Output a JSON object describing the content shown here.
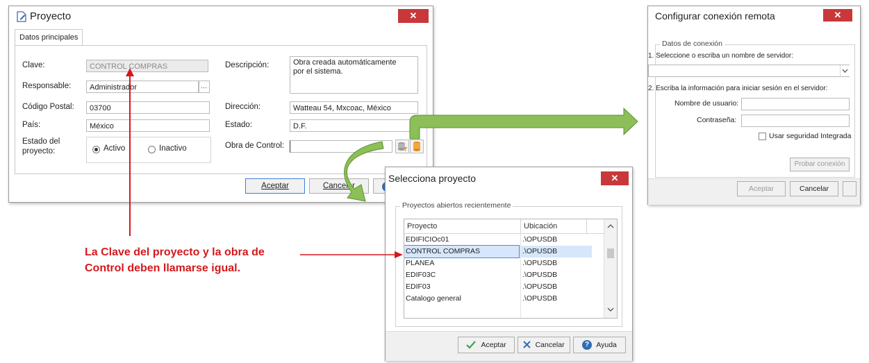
{
  "proyecto_dialog": {
    "title": "Proyecto",
    "close": "✕",
    "tab": "Datos principales",
    "fields": {
      "clave_label": "Clave:",
      "clave_value": "CONTROL COMPRAS",
      "descripcion_label": "Descripción:",
      "descripcion_value": "Obra creada automáticamente por el sistema.",
      "responsable_label": "Responsable:",
      "responsable_value": "Administrador",
      "responsable_button": "···",
      "codigo_postal_label": "Código Postal:",
      "codigo_postal_value": "03700",
      "direccion_label": "Dirección:",
      "direccion_value": "Watteau 54, Mxcoac, México",
      "pais_label": "País:",
      "pais_value": "México",
      "estado_label": "Estado:",
      "estado_value": "D.F.",
      "estado_proyecto_label": "Estado del proyecto:",
      "activo_label": "Activo",
      "inactivo_label": "Inactivo",
      "obra_control_label": "Obra de Control:",
      "obra_control_value": ""
    },
    "buttons": {
      "aceptar": "Aceptar",
      "cancelar": "Cancelar"
    }
  },
  "selecciona_dialog": {
    "title": "Selecciona proyecto",
    "close": "✕",
    "group_title": "Proyectos abiertos recientemente",
    "columns": [
      "Proyecto",
      "Ubicación"
    ],
    "rows": [
      {
        "proyecto": "EDIFICIOc01",
        "ubicacion": ".\\OPUSDB"
      },
      {
        "proyecto": "CONTROL COMPRAS",
        "ubicacion": ".\\OPUSDB"
      },
      {
        "proyecto": "PLANEA",
        "ubicacion": ".\\OPUSDB"
      },
      {
        "proyecto": "EDIF03C",
        "ubicacion": ".\\OPUSDB"
      },
      {
        "proyecto": "EDIF03",
        "ubicacion": ".\\OPUSDB"
      },
      {
        "proyecto": "Catalogo general",
        "ubicacion": ".\\OPUSDB"
      }
    ],
    "buttons": {
      "aceptar": "Aceptar",
      "cancelar": "Cancelar",
      "ayuda": "Ayuda"
    }
  },
  "conexion_dialog": {
    "title": "Configurar conexión remota",
    "close": "✕",
    "group_title": "Datos de conexión",
    "step1": "1. Seleccione o escriba un nombre de servidor:",
    "server_value": "",
    "step2": "2. Escriba la información para iniciar sesión en el servidor:",
    "usuario_label": "Nombre de usuario:",
    "contrasena_label": "Contraseña:",
    "seguridad_label": "Usar seguridad Integrada",
    "probar_button": "Probar conexión",
    "buttons": {
      "aceptar": "Aceptar",
      "cancelar": "Cancelar"
    }
  },
  "annotation": {
    "line1": "La Clave del proyecto y la obra de",
    "line2": "Control deben llamarse igual."
  },
  "colors": {
    "arrow_red": "#d3191c",
    "arrow_green": "#7ab648",
    "close_red": "#c8383a"
  }
}
